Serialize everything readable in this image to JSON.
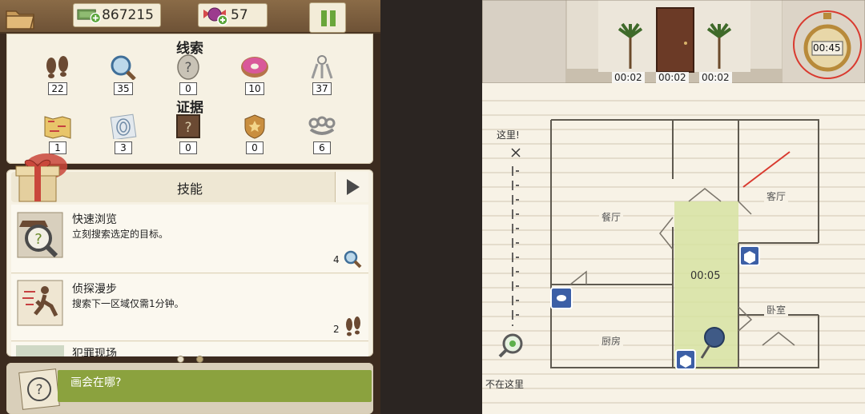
{
  "hud": {
    "cash": "867215",
    "gems": "57"
  },
  "clues": {
    "title": "线索",
    "items": [
      {
        "icon": "footprints-icon",
        "count": "22"
      },
      {
        "icon": "magnifier-icon",
        "count": "35"
      },
      {
        "icon": "question-egg-icon",
        "count": "0"
      },
      {
        "icon": "donut-icon",
        "count": "10"
      },
      {
        "icon": "keyring-icon",
        "count": "37"
      }
    ]
  },
  "evidence": {
    "title": "证据",
    "items": [
      {
        "icon": "map-icon",
        "count": "1"
      },
      {
        "icon": "fingerprint-icon",
        "count": "3"
      },
      {
        "icon": "mystery-photo-icon",
        "count": "0"
      },
      {
        "icon": "police-badge-icon",
        "count": "0"
      },
      {
        "icon": "brass-knuckles-icon",
        "count": "6"
      }
    ]
  },
  "skills": {
    "title": "技能",
    "list": [
      {
        "name": "快速浏览",
        "desc": "立刻搜索选定的目标。",
        "cost": "4",
        "cost_icon": "magnifier-icon"
      },
      {
        "name": "侦探漫步",
        "desc": "搜索下一区域仅需1分钟。",
        "cost": "2",
        "cost_icon": "footprints-icon"
      },
      {
        "name": "犯罪现场",
        "desc": "",
        "cost": "",
        "cost_icon": ""
      }
    ]
  },
  "task": {
    "text": "画会在哪?"
  },
  "map": {
    "stopwatch": "00:45",
    "door_timers": [
      "00:02",
      "00:02",
      "00:02"
    ],
    "here_label": "这里!",
    "not_here_label": "不在这里",
    "highlight_timer": "00:05",
    "rooms": {
      "dining": "餐厅",
      "living": "客厅",
      "bedroom": "卧室",
      "kitchen": "厨房"
    }
  },
  "colors": {
    "accent_green": "#8ba23e",
    "highlight_zone": "#d7e3a2",
    "marker_blue": "#3c5fa6",
    "callout_red": "#d93a2f"
  }
}
